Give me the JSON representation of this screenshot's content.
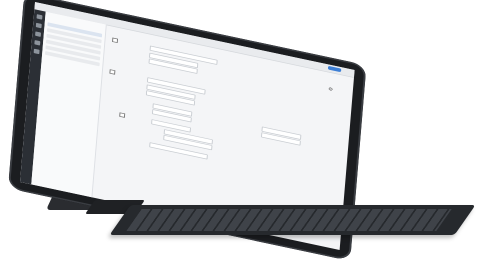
{
  "device": {
    "kind": "tablet-with-keyboard-cover",
    "colors": {
      "bezel": "#1b1d20",
      "keyboard": "#26292d",
      "screen_bg": "#f4f5f7",
      "accent": "#3d7fd6"
    }
  },
  "screen": {
    "topbar": {
      "tabs": [
        "",
        ""
      ],
      "right_items": [
        "",
        ""
      ]
    },
    "sidebar": {
      "title": "",
      "nav_count": 6
    },
    "main": {
      "header": ""
    },
    "icons": [
      "gear-icon"
    ]
  }
}
